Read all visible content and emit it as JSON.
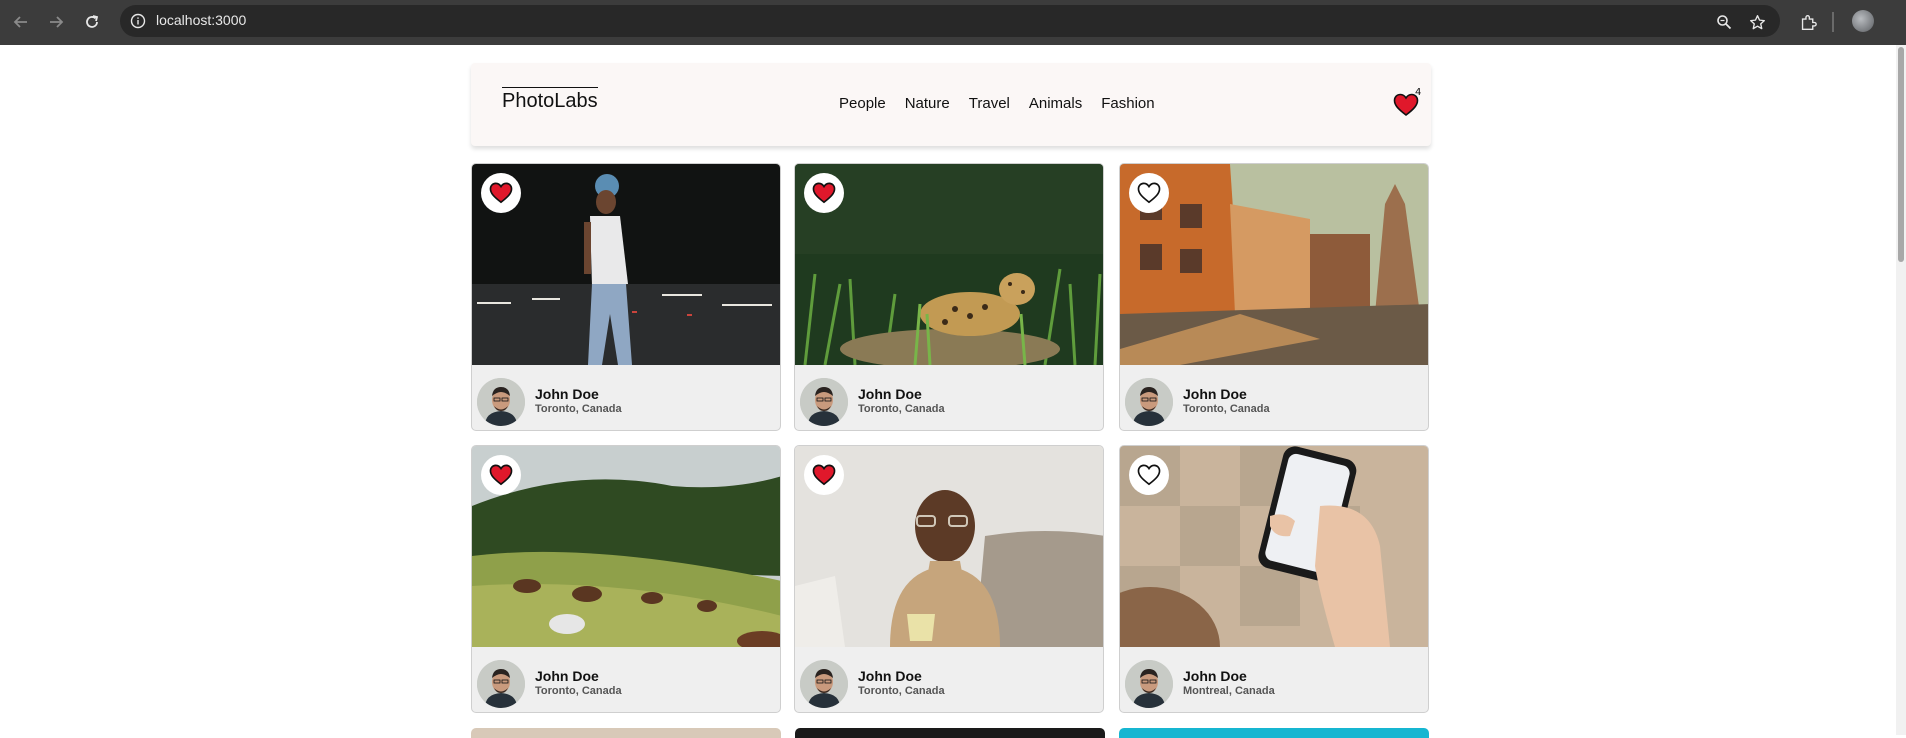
{
  "browser": {
    "url": "localhost:3000",
    "icons": [
      "back-icon",
      "forward-icon",
      "reload-icon",
      "site-info-icon",
      "zoom-icon",
      "bookmark-star-icon",
      "extensions-icon",
      "profile-avatar"
    ]
  },
  "app": {
    "logo": "PhotoLabs",
    "topics": [
      "People",
      "Nature",
      "Travel",
      "Animals",
      "Fashion"
    ],
    "favourites_count": "4",
    "colors": {
      "heart_fill": "#e0182b",
      "topbar_bg": "#fbf7f6",
      "card_bg": "#efefef"
    }
  },
  "photos": [
    {
      "favourited": true,
      "subject": "man-in-cap-street",
      "user": {
        "name": "John Doe",
        "location": "Toronto, Canada"
      }
    },
    {
      "favourited": true,
      "subject": "jaguar-in-grass",
      "user": {
        "name": "John Doe",
        "location": "Toronto, Canada"
      }
    },
    {
      "favourited": false,
      "subject": "old-city-buildings",
      "user": {
        "name": "John Doe",
        "location": "Toronto, Canada"
      }
    },
    {
      "favourited": true,
      "subject": "horses-on-hill",
      "user": {
        "name": "John Doe",
        "location": "Toronto, Canada"
      }
    },
    {
      "favourited": true,
      "subject": "smiling-man-mug",
      "user": {
        "name": "John Doe",
        "location": "Toronto, Canada"
      }
    },
    {
      "favourited": false,
      "subject": "hand-holding-phone",
      "user": {
        "name": "John Doe",
        "location": "Montreal, Canada"
      }
    }
  ]
}
